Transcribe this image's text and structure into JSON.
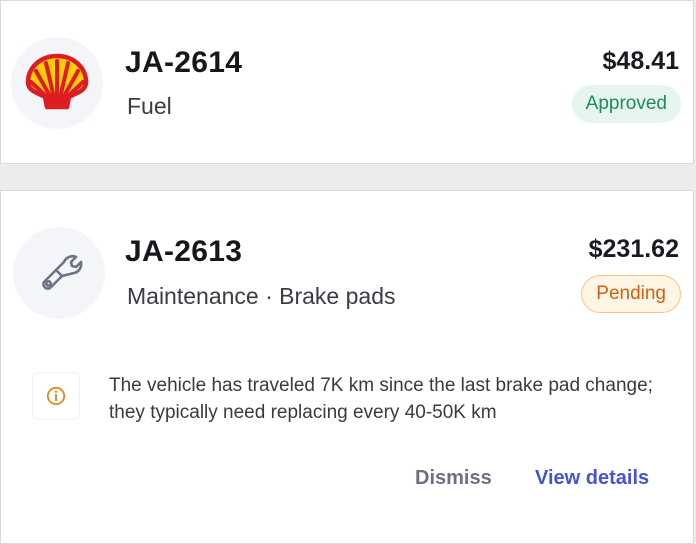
{
  "transactions": [
    {
      "reference": "JA-2614",
      "category": "Fuel",
      "amount": "$48.41",
      "status": "Approved",
      "icon": "shell-logo-icon"
    },
    {
      "reference": "JA-2613",
      "category": "Maintenance · Brake pads",
      "amount": "$231.62",
      "status": "Pending",
      "icon": "wrench-icon",
      "insight": {
        "icon": "info-icon",
        "text": "The vehicle has traveled 7K km since the last brake pad change; they typically need replacing every 40-50K km",
        "dismiss_label": "Dismiss",
        "view_label": "View details"
      }
    }
  ],
  "colors": {
    "approved_text": "#1f8a5a",
    "approved_bg": "#e6f6ef",
    "pending_text": "#d25f12",
    "pending_bg": "#fff5e4",
    "link": "#4553d6",
    "shell_red": "#dd1d21",
    "shell_yellow": "#fbce07"
  }
}
